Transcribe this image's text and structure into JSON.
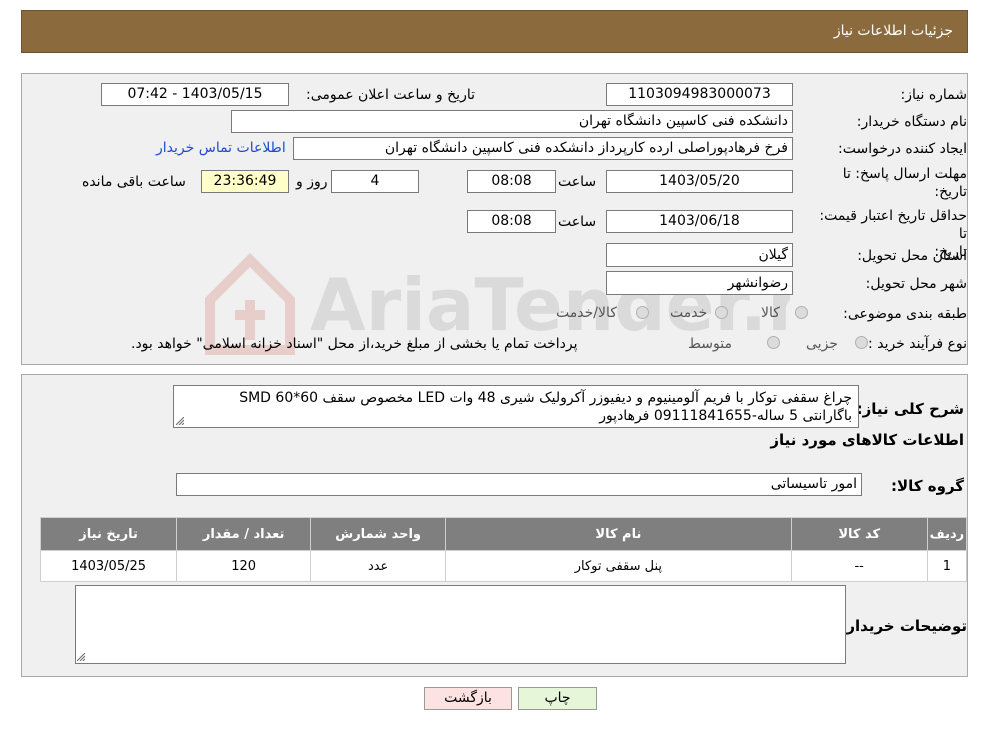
{
  "header": {
    "title": "جزئیات اطلاعات نیاز"
  },
  "form": {
    "need_number_label": "شماره نیاز:",
    "need_number": "1103094983000073",
    "announce_label": "تاریخ و ساعت اعلان عمومی:",
    "announce_value": "1403/05/15 - 07:42",
    "buyer_org_label": "نام دستگاه خریدار:",
    "buyer_org": "دانشکده فنی کاسپین دانشگاه تهران",
    "creator_label": "ایجاد کننده درخواست:",
    "creator": "فرخ فرهادپوراصلی ارده کارپرداز دانشکده فنی کاسپین دانشگاه تهران",
    "contact_link": "اطلاعات تماس خریدار",
    "reply_deadline_label": "مهلت ارسال پاسخ: تا تاریخ:",
    "reply_date": "1403/05/20",
    "time_label": "ساعت",
    "reply_time": "08:08",
    "days_value": "4",
    "days_label": "روز و",
    "remaining_time": "23:36:49",
    "remaining_label": "ساعت باقی مانده",
    "price_validity_label": "حداقل تاریخ اعتبار قیمت: تا تاریخ:",
    "price_date": "1403/06/18",
    "price_time": "08:08",
    "province_label": "استان محل تحویل:",
    "province": "گیلان",
    "city_label": "شهر محل تحویل:",
    "city": "رضوانشهر",
    "category_label": "طبقه بندی موضوعی:",
    "category_options": [
      "کالا",
      "خدمت",
      "کالا/خدمت"
    ],
    "process_label": "نوع فرآیند خرید :",
    "process_options": [
      "جزیی",
      "متوسط"
    ],
    "process_note": "پرداخت تمام یا بخشی از مبلغ خرید،از محل \"اسناد خزانه اسلامی\" خواهد بود."
  },
  "details": {
    "desc_label": "شرح کلی نیاز:",
    "desc_line1": "چراغ سقفی توکار با فریم آلومینیوم و دیفیوزر آکرولیک شیری 48 وات LED مخصوص سقف 60*60 SMD",
    "desc_line2": "باگارانتی 5 ساله-09111841655 فرهادپور",
    "goods_info_title": "اطلاعات کالاهای مورد نیاز",
    "goods_group_label": "گروه کالا:",
    "goods_group": "امور تاسیساتی",
    "table": {
      "headers": [
        "ردیف",
        "کد کالا",
        "نام کالا",
        "واحد شمارش",
        "تعداد / مقدار",
        "تاریخ نیاز"
      ],
      "rows": [
        [
          "1",
          "--",
          "پنل سقفی توکار",
          "عدد",
          "120",
          "1403/05/25"
        ]
      ]
    },
    "buyer_notes_label": "توضیحات خریدار:",
    "buyer_notes": ""
  },
  "buttons": {
    "print": "چاپ",
    "back": "بازگشت"
  },
  "watermark": {
    "text": "AriaTender.neT"
  },
  "colors": {
    "header": "#8b6a3e",
    "table_header": "#7f7f7f",
    "back_button": "#fde2e2",
    "print_button": "#e6f7d9",
    "link": "#1a4dcc"
  }
}
